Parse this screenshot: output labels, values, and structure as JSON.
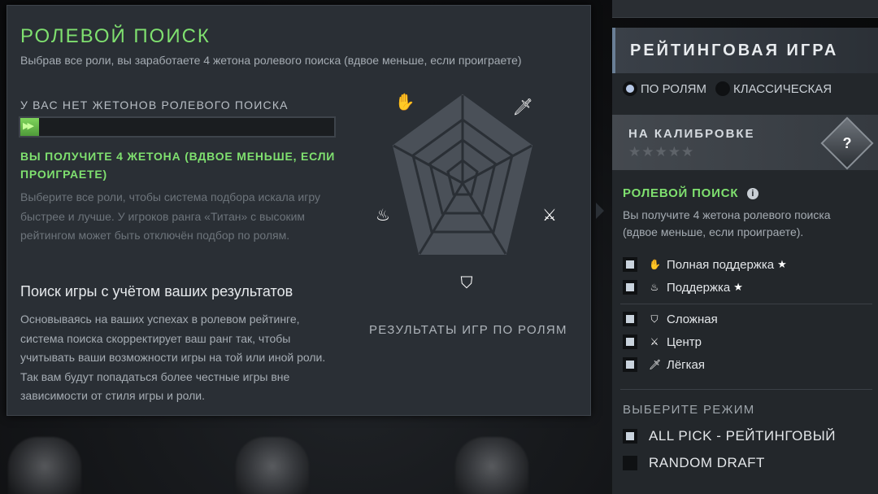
{
  "role_popup": {
    "title": "РОЛЕВОЙ ПОИСК",
    "subtitle": "Выбрав все роли, вы заработаете 4 жетона ролевого поиска (вдвое меньше, если проиграете)",
    "no_tokens": "У ВАС НЕТ ЖЕТОНОВ РОЛЕВОГО ПОИСКА",
    "token_progress": 0.06,
    "get_tokens": "ВЫ ПОЛУЧИТЕ 4 ЖЕТОНА (ВДВОЕ МЕНЬШЕ, ЕСЛИ ПРОИГРАЕТЕ)",
    "hint": "Выберите все роли, чтобы система подбора искала игру быстрее и лучше. У игроков ранга «Титан» с высоким рейтингом может быть отключён подбор по ролям.",
    "section_title": "Поиск игры с учётом ваших результатов",
    "section_text": "Основываясь на ваших успехах в ролевом рейтинге, система поиска скорректирует ваш ранг так, чтобы учитывать ваши возможности игры на той или иной роли. Так вам будут попадаться более честные игры вне зависимости от стиля игры и роли.",
    "radar_label": "РЕЗУЛЬТАТЫ ИГР ПО РОЛЯМ",
    "radar_icons": [
      "hard-support-icon",
      "sword-icon",
      "crossed-arrows-icon",
      "shield-bolt-icon",
      "soft-support-icon"
    ]
  },
  "panel": {
    "ranked_title": "РЕЙТИНГОВАЯ ИГРА",
    "radio_roles": "ПО РОЛЯМ",
    "radio_classic": "КЛАССИЧЕСКАЯ",
    "calibration_title": "НА КАЛИБРОВКЕ",
    "calibration_stars": "★★★★★",
    "calibration_badge": "?",
    "role_search_title": "РОЛЕВОЙ ПОИСК",
    "role_search_text": "Вы получите 4 жетона ролевого поиска (вдвое меньше, если проиграете).",
    "roles": [
      {
        "label": "Полная поддержка",
        "icon": "hard-support-icon",
        "starred": true,
        "checked": true
      },
      {
        "label": "Поддержка",
        "icon": "soft-support-icon",
        "starred": true,
        "checked": true
      },
      {
        "label": "Сложная",
        "icon": "offlane-shield-icon",
        "starred": false,
        "checked": true
      },
      {
        "label": "Центр",
        "icon": "mid-icon",
        "starred": false,
        "checked": true
      },
      {
        "label": "Лёгкая",
        "icon": "carry-sword-icon",
        "starred": false,
        "checked": true
      }
    ],
    "mode_title": "ВЫБЕРИТЕ РЕЖИМ",
    "modes": [
      {
        "label": "ALL PICK - РЕЙТИНГОВЫЙ",
        "checked": true
      },
      {
        "label": "RANDOM DRAFT",
        "checked": false
      }
    ]
  },
  "colors": {
    "accent_green": "#7fe06f",
    "panel_bg": "#23272b",
    "popup_bg": "#2a2f35"
  }
}
